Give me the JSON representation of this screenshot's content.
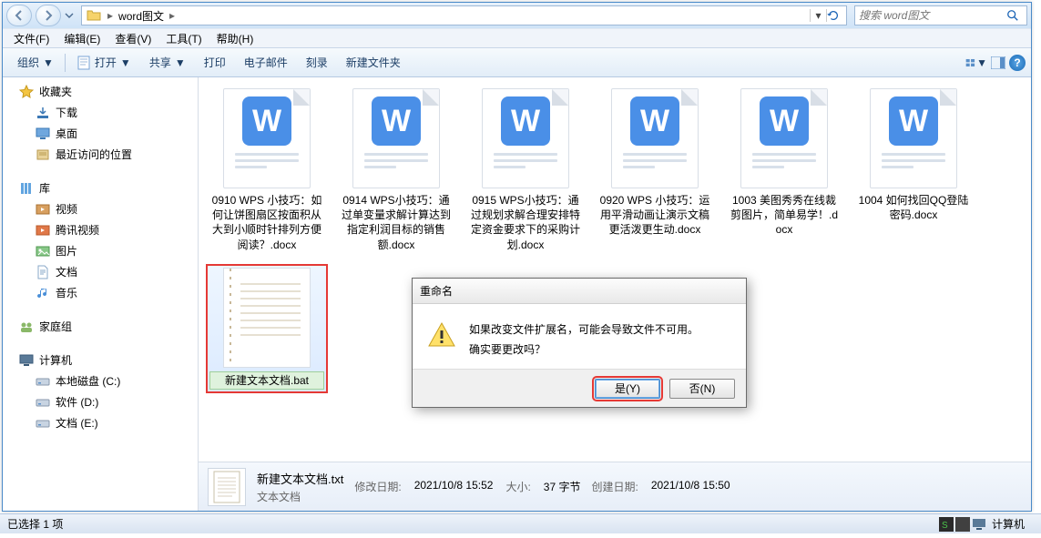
{
  "titlebar": {
    "path_root_icon": "folder",
    "path_segment": "word图文",
    "search_placeholder": "搜索 word图文"
  },
  "menubar": {
    "items": [
      "文件(F)",
      "编辑(E)",
      "查看(V)",
      "工具(T)",
      "帮助(H)"
    ]
  },
  "toolbar": {
    "organize": "组织",
    "open": "打开",
    "share": "共享",
    "print": "打印",
    "email": "电子邮件",
    "burn": "刻录",
    "new_folder": "新建文件夹"
  },
  "nav": {
    "favorites": {
      "label": "收藏夹",
      "items": [
        "下载",
        "桌面",
        "最近访问的位置"
      ]
    },
    "libraries": {
      "label": "库",
      "items": [
        "视频",
        "腾讯视频",
        "图片",
        "文档",
        "音乐"
      ]
    },
    "homegroup": {
      "label": "家庭组"
    },
    "computer": {
      "label": "计算机",
      "items": [
        "本地磁盘 (C:)",
        "软件 (D:)",
        "文档 (E:)"
      ]
    }
  },
  "files": [
    {
      "name": "0910 WPS 小技巧：如何让饼图扇区按面积从大到小顺时针排列方便阅读？.docx",
      "type": "docx"
    },
    {
      "name": "0914  WPS小技巧：通过单变量求解计算达到指定利润目标的销售额.docx",
      "type": "docx"
    },
    {
      "name": "0915 WPS小技巧：通过规划求解合理安排特定资金要求下的采购计划.docx",
      "type": "docx"
    },
    {
      "name": "0920 WPS 小技巧：运用平滑动画让演示文稿更活泼更生动.docx",
      "type": "docx"
    },
    {
      "name": "1003 美图秀秀在线裁剪图片，简单易学！.docx",
      "type": "docx"
    },
    {
      "name": "1004 如何找回QQ登陆密码.docx",
      "type": "docx"
    },
    {
      "name": "新建文本文档.bat",
      "type": "txt",
      "editing": true
    }
  ],
  "details": {
    "title": "新建文本文档.txt",
    "type_label": "文本文档",
    "mod_label": "修改日期:",
    "mod_value": "2021/10/8 15:52",
    "create_label": "创建日期:",
    "create_value": "2021/10/8 15:50",
    "size_label": "大小:",
    "size_value": "37 字节"
  },
  "dialog": {
    "title": "重命名",
    "line1": "如果改变文件扩展名，可能会导致文件不可用。",
    "line2": "确实要更改吗？",
    "yes": "是(Y)",
    "no": "否(N)"
  },
  "statusbar": {
    "selection": "已选择 1 项",
    "computer": "计算机"
  }
}
